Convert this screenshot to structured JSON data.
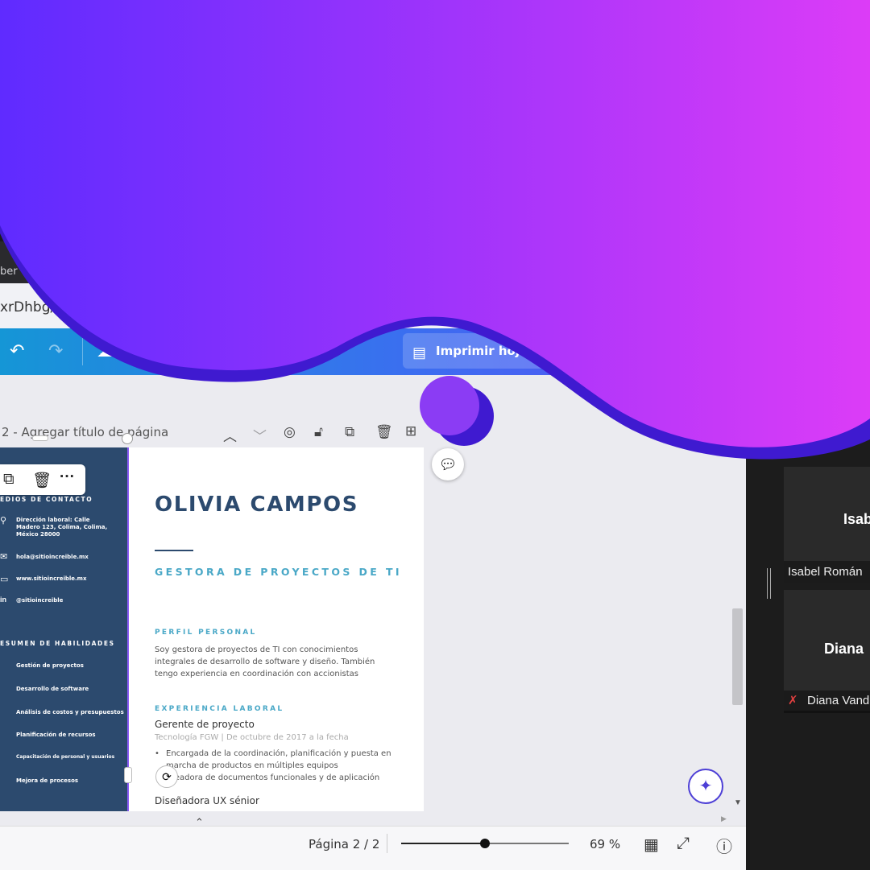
{
  "browser": {
    "tab_fragment": "ber",
    "url_fragment": "xrDhbg/edit"
  },
  "toolbar": {
    "undo_icon": "undo-icon",
    "redo_icon": "redo-icon",
    "cloud_icon": "cloud-check-icon",
    "print_label": "Imprimir hojas c"
  },
  "page_bar": {
    "title": "2 - Agregar título de página"
  },
  "resume": {
    "name": "OLIVIA CAMPOS",
    "role": "GESTORA DE PROYECTOS DE TI",
    "contact_heading": "EDIOS DE CONTACTO",
    "contact": [
      {
        "icon": "location-pin-icon",
        "text": "Dirección laboral: Calle Madero 123, Colima, Colima, México 28000"
      },
      {
        "icon": "mail-icon",
        "text": "hola@sitioincreible.mx"
      },
      {
        "icon": "laptop-icon",
        "text": "www.sitioincreible.mx"
      },
      {
        "icon": "linkedin-icon",
        "text": "@sitioincreible"
      }
    ],
    "skills_heading": "ESUMEN DE HABILIDADES",
    "skills": [
      "Gestión de proyectos",
      "Desarrollo de software",
      "Análisis de costos y presupuestos",
      "Planificación de recursos",
      "Capacitación de personal y usuarios",
      "Mejora de procesos"
    ],
    "profile_heading": "PERFIL PERSONAL",
    "profile_lines": [
      "Soy gestora de proyectos de TI con conocimientos",
      "integrales de desarrollo de software y diseño. También",
      "tengo experiencia en coordinación con accionistas"
    ],
    "experience_heading": "EXPERIENCIA LABORAL",
    "job1_title": "Gerente de proyecto",
    "job1_meta": "Tecnología FGW | De octubre de 2017 a la fecha",
    "job1_bullets": [
      "Encargada de la coordinación, planificación y puesta en",
      "marcha  de productos en múltiples equipos",
      "Creadora de documentos funcionales y de aplicación"
    ],
    "job2_title": "Diseñadora UX sénior"
  },
  "status": {
    "page_label": "Página 2 / 2",
    "zoom_label": "69 %",
    "zoom_fraction": 0.5
  },
  "participants": [
    {
      "tile_name": "Isab",
      "label": "Isabel Román"
    },
    {
      "tile_name": "Diana",
      "label": "Diana Vand",
      "muted": true
    }
  ],
  "colors": {
    "gradient_start": "#5f2bff",
    "gradient_end": "#dc3cf7",
    "gradient_shadow": "#3f1ad0",
    "resume_navy": "#2c4a6e",
    "resume_teal": "#4aa8c7"
  }
}
